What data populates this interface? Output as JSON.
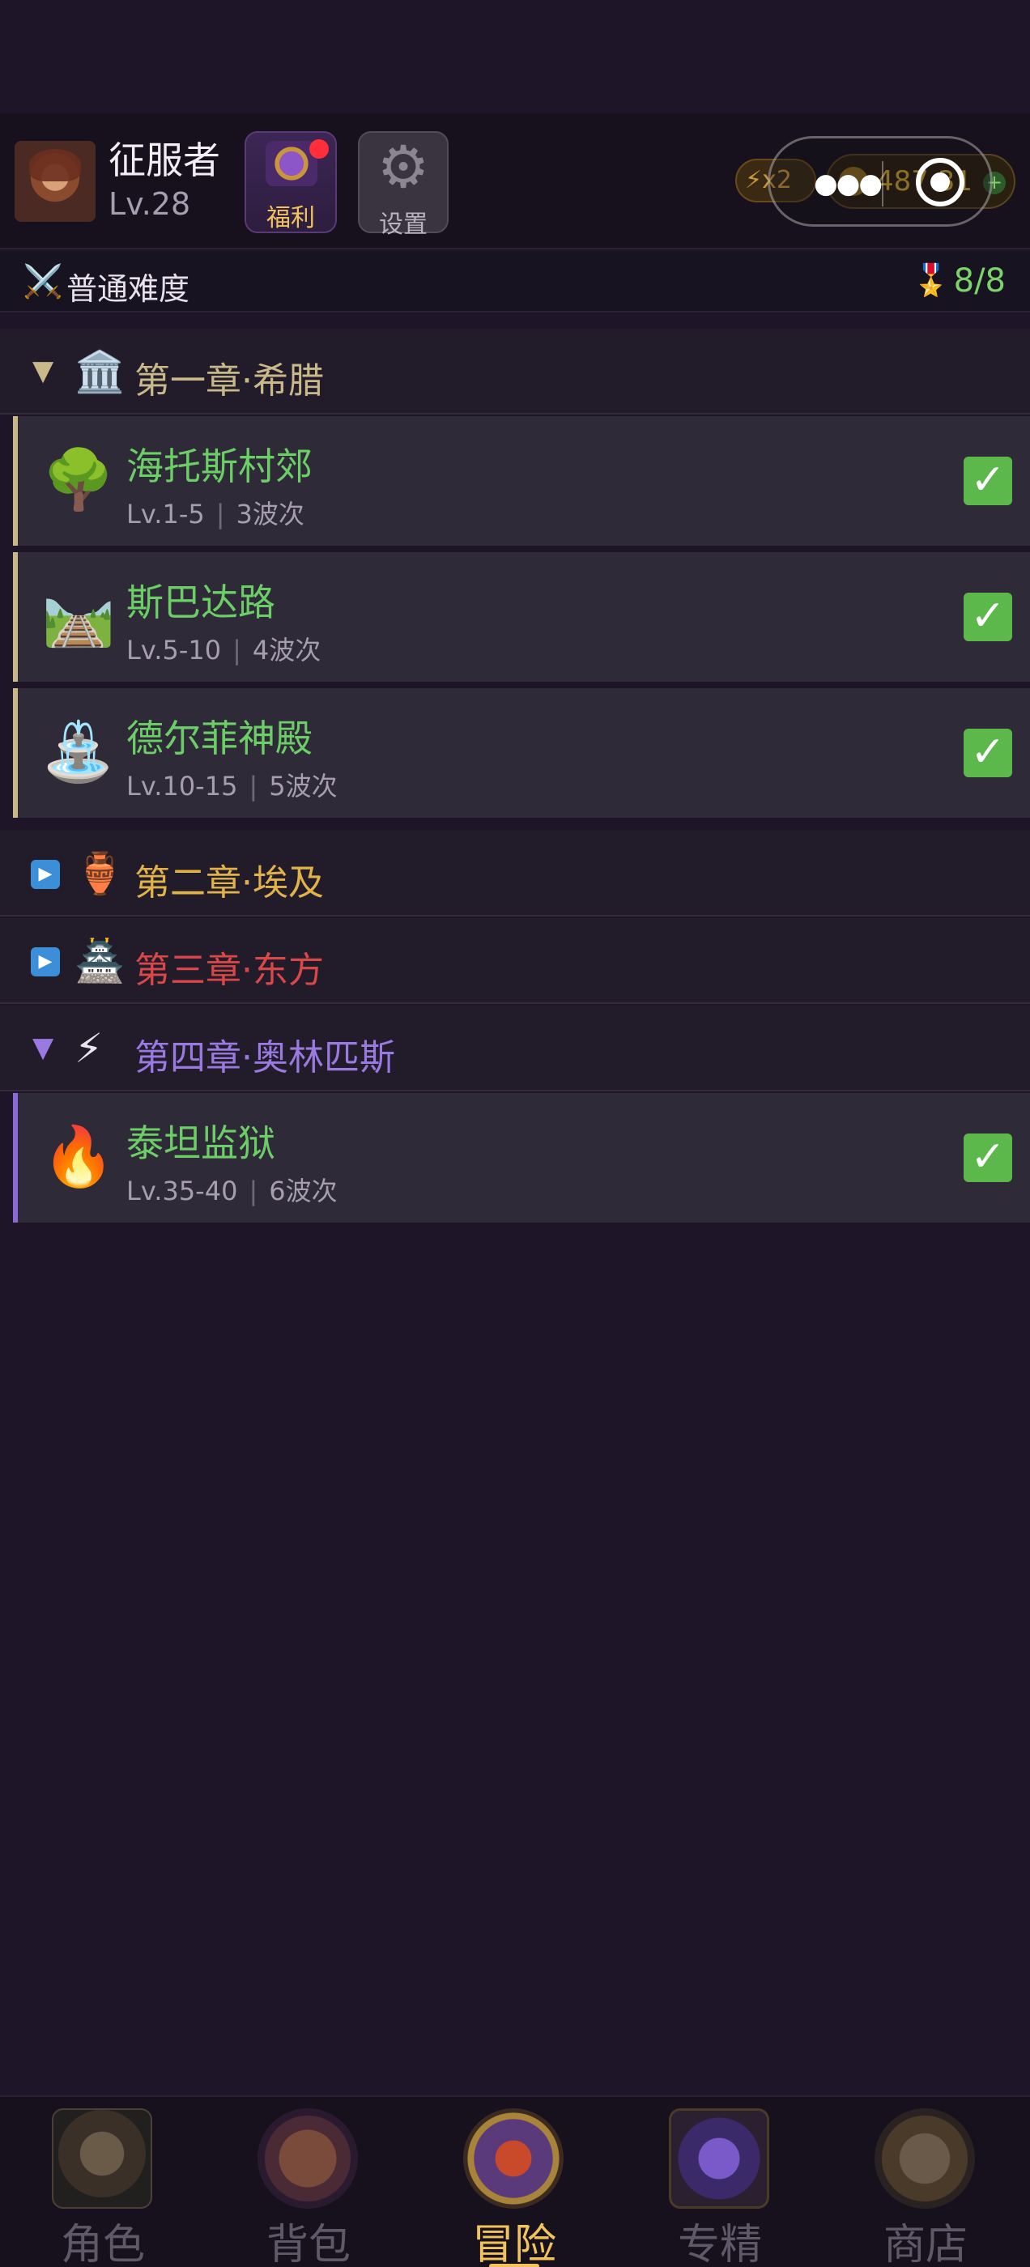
{
  "player": {
    "name": "征服者",
    "level": "Lv.28"
  },
  "header_buttons": {
    "welfare_label": "福利",
    "settings_label": "设置"
  },
  "resources": {
    "energy_text": "x2",
    "coins_text": "487 31"
  },
  "difficulty": {
    "label": "普通难度",
    "progress": "8/8"
  },
  "chapters": [
    {
      "title": "第一章·希腊",
      "color": "#c8b88a",
      "expanded": true,
      "icon": "temple-icon",
      "stages": [
        {
          "name": "海托斯村郊",
          "level": "Lv.1-5",
          "waves": "3波次",
          "icon": "tree-icon",
          "cleared": true
        },
        {
          "name": "斯巴达路",
          "level": "Lv.5-10",
          "waves": "4波次",
          "icon": "railway-icon",
          "cleared": true
        },
        {
          "name": "德尔菲神殿",
          "level": "Lv.10-15",
          "waves": "5波次",
          "icon": "fountain-icon",
          "cleared": true
        }
      ]
    },
    {
      "title": "第二章·埃及",
      "color": "#e2b24a",
      "expanded": false,
      "icon": "amphora-icon"
    },
    {
      "title": "第三章·东方",
      "color": "#d84848",
      "expanded": false,
      "icon": "pagoda-icon"
    },
    {
      "title": "第四章·奥林匹斯",
      "color": "#9a7ae0",
      "expanded": true,
      "icon": "lightning-icon",
      "stages": [
        {
          "name": "泰坦监狱",
          "level": "Lv.35-40",
          "waves": "6波次",
          "icon": "fire-icon",
          "cleared": true
        }
      ]
    }
  ],
  "nav": {
    "items": [
      {
        "label": "角色",
        "icon": "character-icon"
      },
      {
        "label": "背包",
        "icon": "backpack-icon"
      },
      {
        "label": "冒险",
        "icon": "adventure-icon",
        "active": true
      },
      {
        "label": "专精",
        "icon": "mastery-icon"
      },
      {
        "label": "商店",
        "icon": "shop-icon"
      }
    ]
  }
}
